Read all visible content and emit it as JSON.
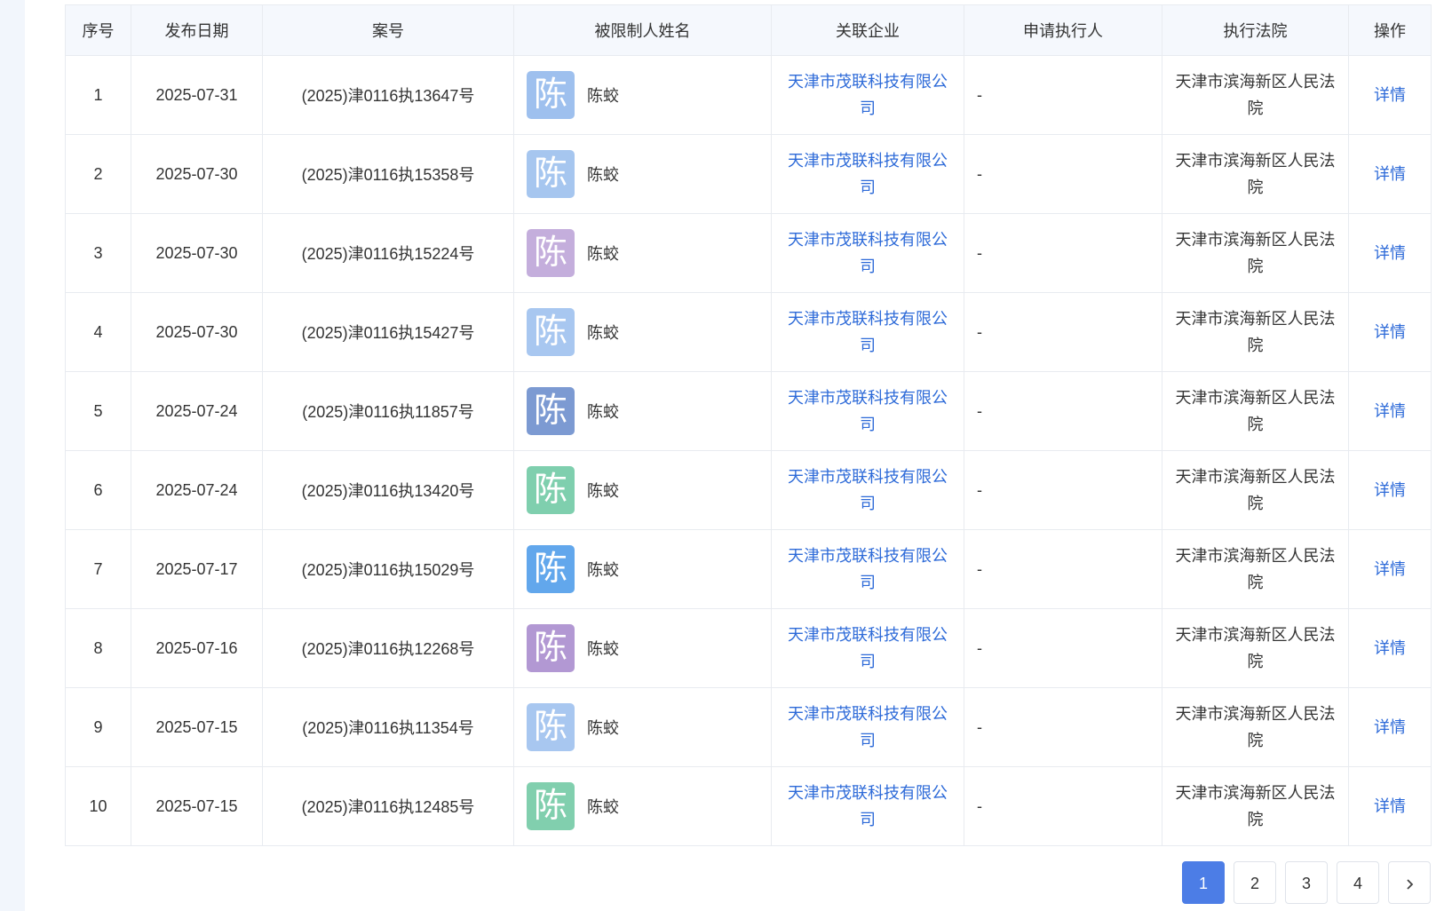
{
  "columns": [
    "序号",
    "发布日期",
    "案号",
    "被限制人姓名",
    "关联企业",
    "申请执行人",
    "执行法院",
    "操作"
  ],
  "avatar_colors": [
    "#9ec0ee",
    "#a6c6ef",
    "#c4aedc",
    "#a8c7f0",
    "#7c9ad2",
    "#7fcfae",
    "#62a7ec",
    "#b298d3",
    "#a8c7f0",
    "#81cfae"
  ],
  "rows": [
    {
      "no": "1",
      "date": "2025-07-31",
      "case": "(2025)津0116执13647号",
      "avatar": "陈",
      "name": "陈蛟",
      "company": "天津市茂联科技有限公司",
      "applicant": "-",
      "court": "天津市滨海新区人民法院",
      "action": "详情"
    },
    {
      "no": "2",
      "date": "2025-07-30",
      "case": "(2025)津0116执15358号",
      "avatar": "陈",
      "name": "陈蛟",
      "company": "天津市茂联科技有限公司",
      "applicant": "-",
      "court": "天津市滨海新区人民法院",
      "action": "详情"
    },
    {
      "no": "3",
      "date": "2025-07-30",
      "case": "(2025)津0116执15224号",
      "avatar": "陈",
      "name": "陈蛟",
      "company": "天津市茂联科技有限公司",
      "applicant": "-",
      "court": "天津市滨海新区人民法院",
      "action": "详情"
    },
    {
      "no": "4",
      "date": "2025-07-30",
      "case": "(2025)津0116执15427号",
      "avatar": "陈",
      "name": "陈蛟",
      "company": "天津市茂联科技有限公司",
      "applicant": "-",
      "court": "天津市滨海新区人民法院",
      "action": "详情"
    },
    {
      "no": "5",
      "date": "2025-07-24",
      "case": "(2025)津0116执11857号",
      "avatar": "陈",
      "name": "陈蛟",
      "company": "天津市茂联科技有限公司",
      "applicant": "-",
      "court": "天津市滨海新区人民法院",
      "action": "详情"
    },
    {
      "no": "6",
      "date": "2025-07-24",
      "case": "(2025)津0116执13420号",
      "avatar": "陈",
      "name": "陈蛟",
      "company": "天津市茂联科技有限公司",
      "applicant": "-",
      "court": "天津市滨海新区人民法院",
      "action": "详情"
    },
    {
      "no": "7",
      "date": "2025-07-17",
      "case": "(2025)津0116执15029号",
      "avatar": "陈",
      "name": "陈蛟",
      "company": "天津市茂联科技有限公司",
      "applicant": "-",
      "court": "天津市滨海新区人民法院",
      "action": "详情"
    },
    {
      "no": "8",
      "date": "2025-07-16",
      "case": "(2025)津0116执12268号",
      "avatar": "陈",
      "name": "陈蛟",
      "company": "天津市茂联科技有限公司",
      "applicant": "-",
      "court": "天津市滨海新区人民法院",
      "action": "详情"
    },
    {
      "no": "9",
      "date": "2025-07-15",
      "case": "(2025)津0116执11354号",
      "avatar": "陈",
      "name": "陈蛟",
      "company": "天津市茂联科技有限公司",
      "applicant": "-",
      "court": "天津市滨海新区人民法院",
      "action": "详情"
    },
    {
      "no": "10",
      "date": "2025-07-15",
      "case": "(2025)津0116执12485号",
      "avatar": "陈",
      "name": "陈蛟",
      "company": "天津市茂联科技有限公司",
      "applicant": "-",
      "court": "天津市滨海新区人民法院",
      "action": "详情"
    }
  ],
  "pagination": {
    "pages": [
      "1",
      "2",
      "3",
      "4"
    ],
    "current": "1",
    "next_icon": "chevron-right-icon"
  }
}
